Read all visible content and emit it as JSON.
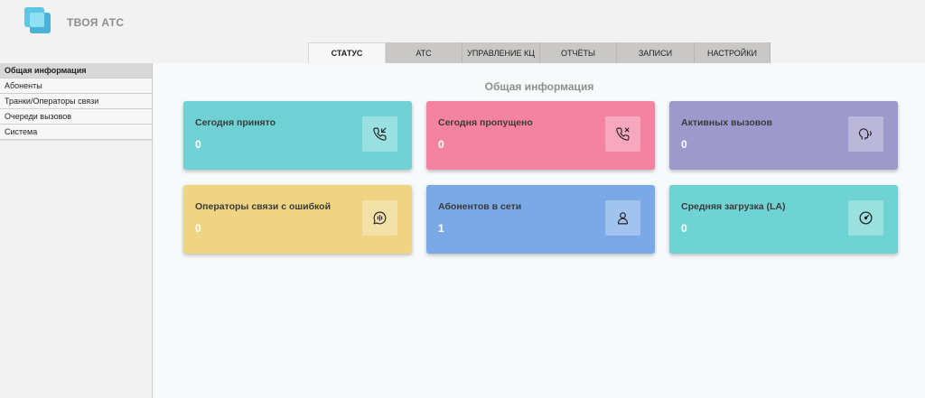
{
  "header": {
    "brand": "ТВОЯ АТС"
  },
  "tabs": [
    {
      "label": "СТАТУС",
      "active": true
    },
    {
      "label": "АТС"
    },
    {
      "label": "УПРАВЛЕНИЕ КЦ"
    },
    {
      "label": "ОТЧЁТЫ"
    },
    {
      "label": "ЗАПИСИ"
    },
    {
      "label": "НАСТРОЙКИ"
    }
  ],
  "sidebar": {
    "items": [
      {
        "label": "Общая информация",
        "active": true
      },
      {
        "label": "Абоненты"
      },
      {
        "label": "Транки/Операторы связи"
      },
      {
        "label": "Очереди вызовов"
      },
      {
        "label": "Система"
      }
    ]
  },
  "main": {
    "title": "Общая информация",
    "cards": [
      {
        "title": "Сегодня принято",
        "value": "0",
        "color": "#6fd1d4",
        "icon": "incoming-call-icon"
      },
      {
        "title": "Сегодня пропущено",
        "value": "0",
        "color": "#f483a2",
        "icon": "missed-call-icon"
      },
      {
        "title": "Активных вызовов",
        "value": "0",
        "color": "#9d99cc",
        "icon": "speaking-head-icon"
      },
      {
        "title": "Операторы связи с ошибкой",
        "value": "0",
        "color": "#efd483",
        "icon": "voice-chat-icon"
      },
      {
        "title": "Абонентов в сети",
        "value": "1",
        "color": "#7aa9e8",
        "icon": "user-icon"
      },
      {
        "title": "Средняя загрузка (LA)",
        "value": "0",
        "color": "#70d3d3",
        "icon": "gauge-icon"
      }
    ]
  }
}
